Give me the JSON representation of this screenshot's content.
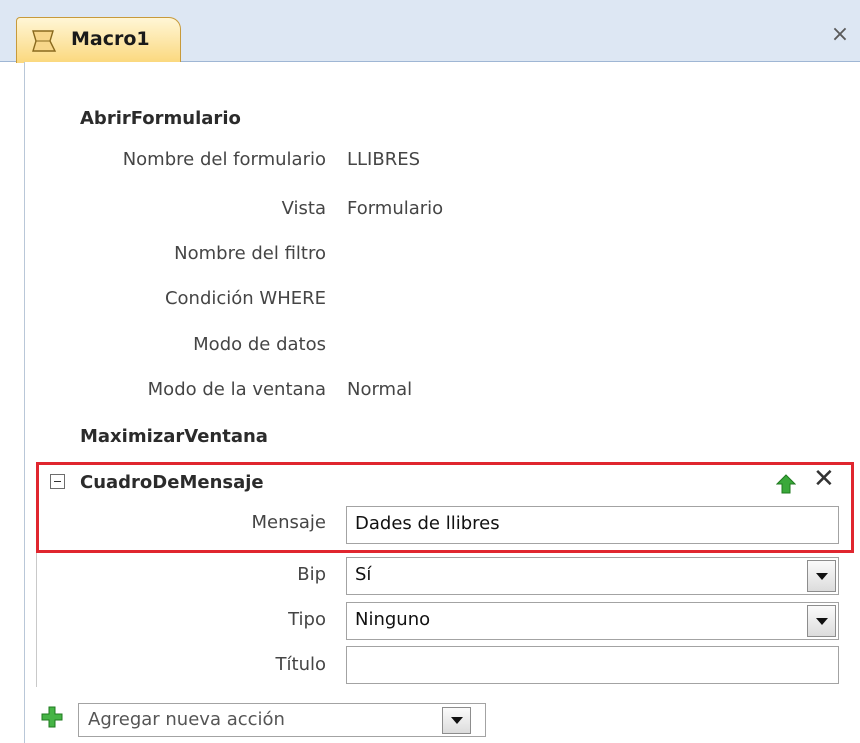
{
  "tab": {
    "title": "Macro1",
    "close": "×"
  },
  "actions": [
    {
      "title": "AbrirFormulario",
      "args": [
        {
          "label": "Nombre del formulario",
          "value": "LLIBRES"
        },
        {
          "label": "Vista",
          "value": "Formulario"
        },
        {
          "label": "Nombre del filtro",
          "value": ""
        },
        {
          "label": "Condición WHERE",
          "value": ""
        },
        {
          "label": "Modo de datos",
          "value": ""
        },
        {
          "label": "Modo de la ventana",
          "value": "Normal"
        }
      ]
    },
    {
      "title": "MaximizarVentana"
    }
  ],
  "selected_action": {
    "title": "CuadroDeMensaje",
    "delete_glyph": "✕",
    "fields": {
      "mensaje": {
        "label": "Mensaje",
        "value": "Dades de llibres"
      },
      "bip": {
        "label": "Bip",
        "value": "Sí"
      },
      "tipo": {
        "label": "Tipo",
        "value": "Ninguno"
      },
      "titulo": {
        "label": "Título",
        "value": ""
      }
    }
  },
  "add_action": {
    "placeholder": "Agregar nueva acción"
  },
  "colors": {
    "highlight": "#e0262f",
    "tab": "#fbd87d",
    "accent_green": "#3aa93a"
  }
}
